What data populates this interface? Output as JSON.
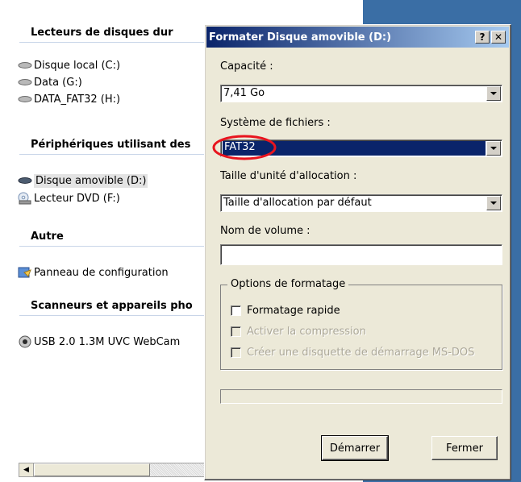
{
  "explorer": {
    "groups": [
      {
        "header": "Lecteurs de disques dur",
        "items": [
          {
            "label": "Disque local (C:)",
            "icon": "hard-drive-icon"
          },
          {
            "label": "Data (G:)",
            "icon": "hard-drive-icon"
          },
          {
            "label": "DATA_FAT32 (H:)",
            "icon": "hard-drive-icon"
          }
        ]
      },
      {
        "header": "Périphériques utilisant des",
        "items": [
          {
            "label": "Disque amovible (D:)",
            "icon": "removable-drive-icon"
          },
          {
            "label": "Lecteur DVD (F:)",
            "icon": "dvd-drive-icon"
          }
        ]
      },
      {
        "header": "Autre",
        "items": [
          {
            "label": "Panneau de configuration",
            "icon": "control-panel-icon"
          }
        ]
      },
      {
        "header": "Scanneurs et appareils pho",
        "items": [
          {
            "label": "USB 2.0 1.3M UVC WebCam",
            "icon": "webcam-icon"
          }
        ]
      }
    ]
  },
  "dialog": {
    "title": "Formater Disque amovible (D:)",
    "help_btn": "?",
    "close_btn": "✕",
    "capacity_label": "Capacité :",
    "capacity_value": "7,41 Go",
    "filesystem_label": "Système de fichiers :",
    "filesystem_value": "FAT32",
    "alloc_label": "Taille d'unité d'allocation :",
    "alloc_value": "Taille d'allocation par défaut",
    "volume_label": "Nom de volume :",
    "volume_value": "",
    "options_legend": "Options de formatage",
    "opt_quick": "Formatage rapide",
    "opt_compress": "Activer la compression",
    "opt_msdos": "Créer une disquette de démarrage MS-DOS",
    "start_btn": "Démarrer",
    "close_label": "Fermer"
  },
  "colors": {
    "title_start": "#0a246a",
    "title_end": "#a6caf0",
    "highlight": "#0a246a",
    "annotation": "#e8141e"
  }
}
